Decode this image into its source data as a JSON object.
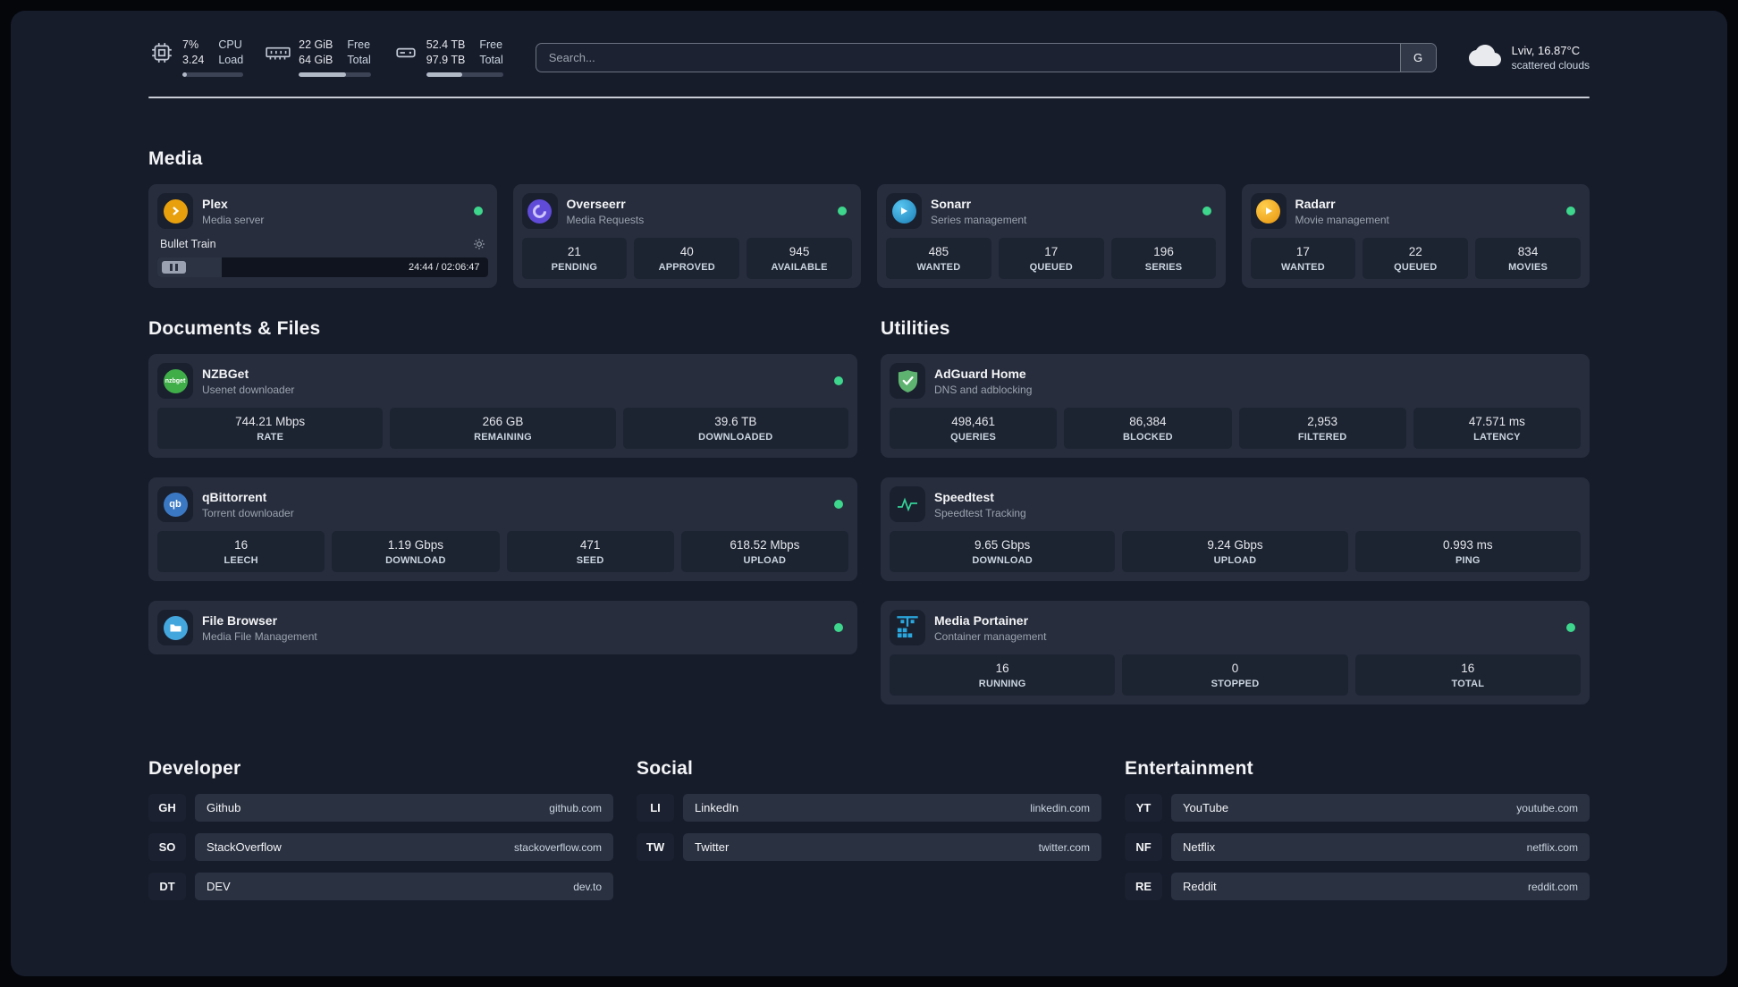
{
  "topbar": {
    "cpu": {
      "value_top": "7%",
      "value_bottom": "3.24",
      "label_top": "CPU",
      "label_bottom": "Load",
      "progress": 7
    },
    "memory": {
      "value_top": "22 GiB",
      "value_bottom": "64 GiB",
      "label_top": "Free",
      "label_bottom": "Total",
      "progress": 66
    },
    "disk": {
      "value_top": "52.4 TB",
      "value_bottom": "97.9 TB",
      "label_top": "Free",
      "label_bottom": "Total",
      "progress": 47
    },
    "search": {
      "placeholder": "Search...",
      "button_label": "G"
    },
    "weather": {
      "location": "Lviv, 16.87°C",
      "condition": "scattered clouds"
    }
  },
  "section_titles": {
    "media": "Media",
    "documents": "Documents & Files",
    "utilities": "Utilities",
    "developer": "Developer",
    "social": "Social",
    "entertainment": "Entertainment"
  },
  "services": {
    "plex": {
      "name": "Plex",
      "description": "Media server",
      "now_playing": "Bullet Train",
      "elapsed_total": "24:44 / 02:06:47",
      "progress": 19.5
    },
    "overseerr": {
      "name": "Overseerr",
      "description": "Media Requests",
      "stats": [
        {
          "value": "21",
          "label": "PENDING"
        },
        {
          "value": "40",
          "label": "APPROVED"
        },
        {
          "value": "945",
          "label": "AVAILABLE"
        }
      ]
    },
    "sonarr": {
      "name": "Sonarr",
      "description": "Series management",
      "stats": [
        {
          "value": "485",
          "label": "WANTED"
        },
        {
          "value": "17",
          "label": "QUEUED"
        },
        {
          "value": "196",
          "label": "SERIES"
        }
      ]
    },
    "radarr": {
      "name": "Radarr",
      "description": "Movie management",
      "stats": [
        {
          "value": "17",
          "label": "WANTED"
        },
        {
          "value": "22",
          "label": "QUEUED"
        },
        {
          "value": "834",
          "label": "MOVIES"
        }
      ]
    },
    "nzbget": {
      "name": "NZBGet",
      "description": "Usenet downloader",
      "stats": [
        {
          "value": "744.21 Mbps",
          "label": "RATE"
        },
        {
          "value": "266 GB",
          "label": "REMAINING"
        },
        {
          "value": "39.6 TB",
          "label": "DOWNLOADED"
        }
      ]
    },
    "qbittorrent": {
      "name": "qBittorrent",
      "description": "Torrent downloader",
      "stats": [
        {
          "value": "16",
          "label": "LEECH"
        },
        {
          "value": "1.19 Gbps",
          "label": "DOWNLOAD"
        },
        {
          "value": "471",
          "label": "SEED"
        },
        {
          "value": "618.52 Mbps",
          "label": "UPLOAD"
        }
      ]
    },
    "filebrowser": {
      "name": "File Browser",
      "description": "Media File Management"
    },
    "adguard": {
      "name": "AdGuard Home",
      "description": "DNS and adblocking",
      "stats": [
        {
          "value": "498,461",
          "label": "QUERIES"
        },
        {
          "value": "86,384",
          "label": "BLOCKED"
        },
        {
          "value": "2,953",
          "label": "FILTERED"
        },
        {
          "value": "47.571 ms",
          "label": "LATENCY"
        }
      ]
    },
    "speedtest": {
      "name": "Speedtest",
      "description": "Speedtest Tracking",
      "stats": [
        {
          "value": "9.65 Gbps",
          "label": "DOWNLOAD"
        },
        {
          "value": "9.24 Gbps",
          "label": "UPLOAD"
        },
        {
          "value": "0.993 ms",
          "label": "PING"
        }
      ]
    },
    "portainer": {
      "name": "Media Portainer",
      "description": "Container management",
      "stats": [
        {
          "value": "16",
          "label": "RUNNING"
        },
        {
          "value": "0",
          "label": "STOPPED"
        },
        {
          "value": "16",
          "label": "TOTAL"
        }
      ]
    }
  },
  "bookmarks": {
    "developer": [
      {
        "abbr": "GH",
        "name": "Github",
        "url": "github.com"
      },
      {
        "abbr": "SO",
        "name": "StackOverflow",
        "url": "stackoverflow.com"
      },
      {
        "abbr": "DT",
        "name": "DEV",
        "url": "dev.to"
      }
    ],
    "social": [
      {
        "abbr": "LI",
        "name": "LinkedIn",
        "url": "linkedin.com"
      },
      {
        "abbr": "TW",
        "name": "Twitter",
        "url": "twitter.com"
      }
    ],
    "entertainment": [
      {
        "abbr": "YT",
        "name": "YouTube",
        "url": "youtube.com"
      },
      {
        "abbr": "NF",
        "name": "Netflix",
        "url": "netflix.com"
      },
      {
        "abbr": "RE",
        "name": "Reddit",
        "url": "reddit.com"
      }
    ]
  },
  "colors": {
    "status_online": "#3dd68c",
    "plex": "#e8a00d",
    "overseerr": "#5f4bd8",
    "sonarr": "#36a6d8",
    "radarr": "#f0a32e",
    "nzbget": "#3fae49",
    "qbittorrent": "#3b78c4",
    "filebrowser": "#43a6dd",
    "adguard": "#5fb370",
    "speedtest_wave": "#34d399",
    "portainer": "#2aa7de"
  }
}
